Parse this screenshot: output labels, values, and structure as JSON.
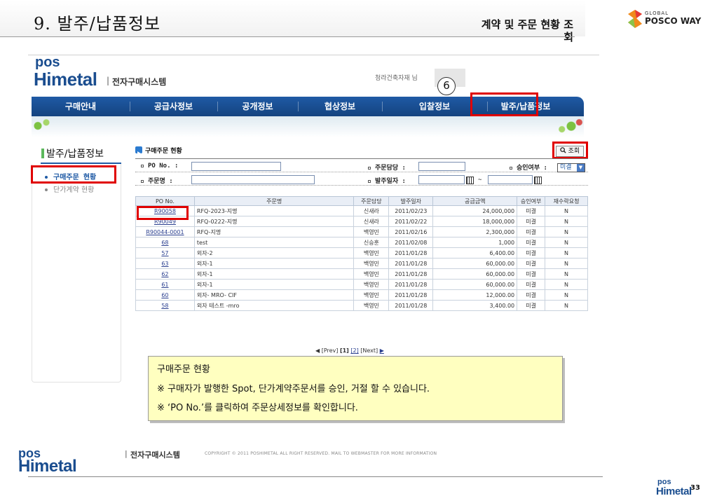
{
  "slide": {
    "title": "9. 발주/납품정보",
    "section": "계약 및 주문 현황 조회",
    "page_number": "33",
    "posco_logo_global": "GLOBAL",
    "posco_logo_word": "POSCO WAY"
  },
  "app": {
    "logo_pos": "pos",
    "logo_himetal": "Himetal",
    "system_sep": "|",
    "system_name": "전자구매시스템",
    "user_greeting": "청라건축자재 님",
    "callout_number": "6"
  },
  "nav": {
    "items": [
      "구매안내",
      "공급사정보",
      "공개정보",
      "협상정보",
      "입찰정보",
      "발주/납품정보"
    ]
  },
  "sidebar": {
    "title": "발주/납품정보",
    "items": [
      "구매주문 현황",
      "단가계약 현황"
    ]
  },
  "content": {
    "title": "구매주문 현황",
    "search_label": "조회",
    "filters": {
      "po_no_label": "PO No.",
      "order_name_label": "주문명",
      "manager_label": "주문담당",
      "order_date_label": "발주일자",
      "date_sep": "~",
      "approval_label": "승인여부",
      "approval_value": "미결",
      "colon": ":"
    }
  },
  "table": {
    "headers": [
      "PO No.",
      "주문명",
      "주문담당",
      "발주일자",
      "공급금액",
      "승인여부",
      "재수락요청"
    ],
    "rows": [
      [
        "R90058",
        "RFQ-2023-지명",
        "신새라",
        "2011/02/23",
        "24,000,000",
        "미결",
        "N"
      ],
      [
        "R90049",
        "RFQ-0222-지명",
        "신새라",
        "2011/02/22",
        "18,000,000",
        "미결",
        "N"
      ],
      [
        "R90044-0001",
        "RFQ-지명",
        "백영민",
        "2011/02/16",
        "2,300,000",
        "미결",
        "N"
      ],
      [
        "68",
        "test",
        "신승훈",
        "2011/02/08",
        "1,000",
        "미결",
        "N"
      ],
      [
        "57",
        "외자-2",
        "백영민",
        "2011/01/28",
        "6,400.00",
        "미결",
        "N"
      ],
      [
        "63",
        "외자-1",
        "백영민",
        "2011/01/28",
        "60,000.00",
        "미결",
        "N"
      ],
      [
        "62",
        "외자-1",
        "백영민",
        "2011/01/28",
        "60,000.00",
        "미결",
        "N"
      ],
      [
        "61",
        "외자-1",
        "백영민",
        "2011/01/28",
        "60,000.00",
        "미결",
        "N"
      ],
      [
        "60",
        "외자- MRO- CIF",
        "백영민",
        "2011/01/28",
        "12,000.00",
        "미결",
        "N"
      ],
      [
        "58",
        "외자 테스트 -mro",
        "백영민",
        "2011/01/28",
        "3,400.00",
        "미결",
        "N"
      ]
    ]
  },
  "pagination": {
    "prev": "◀ [Prev]",
    "current": "[1]",
    "page2": "[2]",
    "next": "[Next]",
    "next_arrow": "▶"
  },
  "note": {
    "title": "구매주문 현황",
    "line1": "※ 구매자가 발행한 Spot, 단가계약주문서를 승인, 거절 할 수 있습니다.",
    "line2": "※ ‘PO No.’를 클릭하여 주문상세정보를 확인합니다."
  },
  "footer": {
    "system_sep": "|",
    "system_name": "전자구매시스템",
    "copyright": "COPYRIGHT © 2011 POSHIMETAL ALL RIGHT RESERVED. MAIL TO WEBMASTER FOR MORE INFORMATION"
  },
  "colors": {
    "nav_blue": "#1f5aa5",
    "highlight_red": "#e00000",
    "note_yellow": "#ffffc0"
  }
}
